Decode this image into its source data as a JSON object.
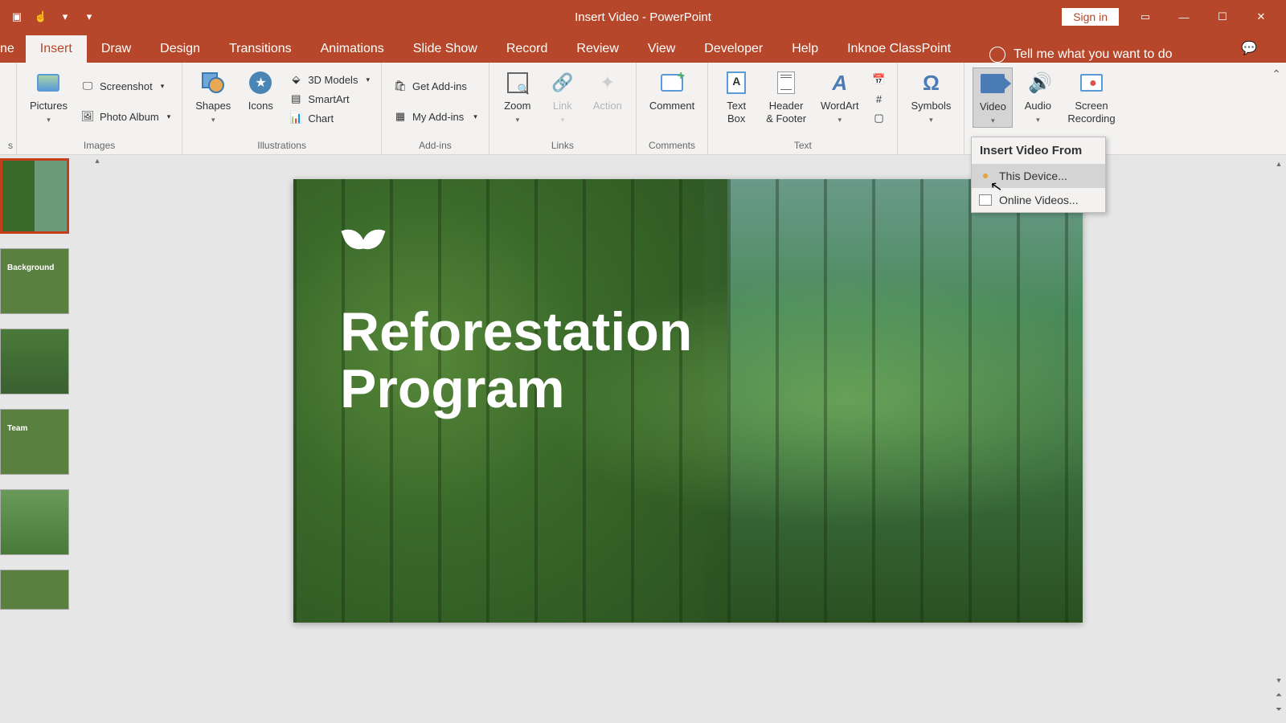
{
  "titlebar": {
    "title": "Insert Video  -  PowerPoint",
    "signin": "Sign in"
  },
  "tabs": {
    "home_cut": "ne",
    "insert": "Insert",
    "draw": "Draw",
    "design": "Design",
    "transitions": "Transitions",
    "animations": "Animations",
    "slideshow": "Slide Show",
    "record": "Record",
    "review": "Review",
    "view": "View",
    "developer": "Developer",
    "help": "Help",
    "classpoint": "Inknoe ClassPoint",
    "tellme": "Tell me what you want to do"
  },
  "ribbon": {
    "pictures": "Pictures",
    "screenshot": "Screenshot",
    "photoalbum": "Photo Album",
    "images_group": "Images",
    "shapes": "Shapes",
    "icons": "Icons",
    "models3d": "3D Models",
    "smartart": "SmartArt",
    "chart": "Chart",
    "illustrations_group": "Illustrations",
    "getaddins": "Get Add-ins",
    "myaddins": "My Add-ins",
    "addins_group": "Add-ins",
    "zoom": "Zoom",
    "link": "Link",
    "action": "Action",
    "links_group": "Links",
    "comment": "Comment",
    "comments_group": "Comments",
    "textbox": "Text\nBox",
    "headerfooter": "Header\n& Footer",
    "wordart": "WordArt",
    "text_group": "Text",
    "symbols": "Symbols",
    "video": "Video",
    "audio": "Audio",
    "screenrecording": "Screen\nRecording"
  },
  "video_menu": {
    "header": "Insert Video From",
    "this_device": "This Device...",
    "online": "Online Videos..."
  },
  "slide": {
    "title_l1": "Reforestation",
    "title_l2": "Program"
  },
  "thumbs": {
    "t2": "Background",
    "t4": "Team"
  }
}
